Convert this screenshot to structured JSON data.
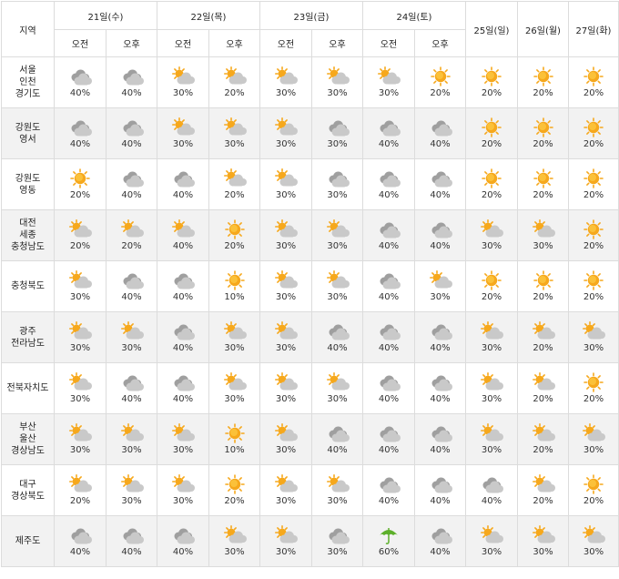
{
  "header": {
    "region_label": "지역",
    "days_split": [
      {
        "label": "21일(수)",
        "slots": [
          "오전",
          "오후"
        ]
      },
      {
        "label": "22일(목)",
        "slots": [
          "오전",
          "오후"
        ]
      },
      {
        "label": "23일(금)",
        "slots": [
          "오전",
          "오후"
        ]
      },
      {
        "label": "24일(토)",
        "slots": [
          "오전",
          "오후"
        ]
      }
    ],
    "days_single": [
      "25일(일)",
      "26일(월)",
      "27일(화)"
    ]
  },
  "rows": [
    {
      "region": [
        "서울",
        "인천",
        "경기도"
      ],
      "cells": [
        [
          "cloudy",
          "40%"
        ],
        [
          "cloudy",
          "40%"
        ],
        [
          "partly-sunny",
          "30%"
        ],
        [
          "partly-sunny",
          "20%"
        ],
        [
          "partly-sunny",
          "30%"
        ],
        [
          "partly-sunny",
          "30%"
        ],
        [
          "partly-sunny",
          "30%"
        ],
        [
          "sunny",
          "20%"
        ],
        [
          "sunny",
          "20%"
        ],
        [
          "sunny",
          "20%"
        ],
        [
          "sunny",
          "20%"
        ]
      ]
    },
    {
      "region": [
        "강원도",
        "영서"
      ],
      "cells": [
        [
          "cloudy",
          "40%"
        ],
        [
          "cloudy",
          "40%"
        ],
        [
          "partly-sunny",
          "30%"
        ],
        [
          "partly-sunny",
          "30%"
        ],
        [
          "partly-sunny",
          "30%"
        ],
        [
          "cloudy",
          "30%"
        ],
        [
          "cloudy",
          "40%"
        ],
        [
          "cloudy",
          "40%"
        ],
        [
          "sunny",
          "20%"
        ],
        [
          "sunny",
          "20%"
        ],
        [
          "sunny",
          "20%"
        ]
      ]
    },
    {
      "region": [
        "강원도",
        "영동"
      ],
      "cells": [
        [
          "sunny",
          "20%"
        ],
        [
          "cloudy",
          "40%"
        ],
        [
          "cloudy",
          "40%"
        ],
        [
          "partly-sunny",
          "20%"
        ],
        [
          "partly-sunny",
          "30%"
        ],
        [
          "cloudy",
          "30%"
        ],
        [
          "cloudy",
          "40%"
        ],
        [
          "cloudy",
          "40%"
        ],
        [
          "sunny",
          "20%"
        ],
        [
          "sunny",
          "20%"
        ],
        [
          "sunny",
          "20%"
        ]
      ]
    },
    {
      "region": [
        "대전",
        "세종",
        "충청남도"
      ],
      "cells": [
        [
          "partly-sunny",
          "20%"
        ],
        [
          "partly-sunny",
          "20%"
        ],
        [
          "partly-sunny",
          "40%"
        ],
        [
          "sunny",
          "20%"
        ],
        [
          "partly-sunny",
          "30%"
        ],
        [
          "partly-sunny",
          "30%"
        ],
        [
          "cloudy",
          "40%"
        ],
        [
          "cloudy",
          "40%"
        ],
        [
          "partly-sunny",
          "30%"
        ],
        [
          "partly-sunny",
          "30%"
        ],
        [
          "sunny",
          "20%"
        ]
      ]
    },
    {
      "region": [
        "충청북도"
      ],
      "cells": [
        [
          "partly-sunny",
          "30%"
        ],
        [
          "cloudy",
          "40%"
        ],
        [
          "cloudy",
          "40%"
        ],
        [
          "sunny",
          "10%"
        ],
        [
          "partly-sunny",
          "30%"
        ],
        [
          "partly-sunny",
          "30%"
        ],
        [
          "cloudy",
          "40%"
        ],
        [
          "partly-sunny",
          "30%"
        ],
        [
          "sunny",
          "20%"
        ],
        [
          "sunny",
          "20%"
        ],
        [
          "sunny",
          "20%"
        ]
      ]
    },
    {
      "region": [
        "광주",
        "전라남도"
      ],
      "cells": [
        [
          "partly-sunny",
          "30%"
        ],
        [
          "partly-sunny",
          "30%"
        ],
        [
          "cloudy",
          "40%"
        ],
        [
          "partly-sunny",
          "30%"
        ],
        [
          "partly-sunny",
          "30%"
        ],
        [
          "cloudy",
          "40%"
        ],
        [
          "cloudy",
          "40%"
        ],
        [
          "cloudy",
          "40%"
        ],
        [
          "partly-sunny",
          "30%"
        ],
        [
          "partly-sunny",
          "20%"
        ],
        [
          "partly-sunny",
          "30%"
        ]
      ]
    },
    {
      "region": [
        "전북자치도"
      ],
      "cells": [
        [
          "partly-sunny",
          "30%"
        ],
        [
          "cloudy",
          "40%"
        ],
        [
          "cloudy",
          "40%"
        ],
        [
          "partly-sunny",
          "30%"
        ],
        [
          "partly-sunny",
          "30%"
        ],
        [
          "partly-sunny",
          "30%"
        ],
        [
          "cloudy",
          "40%"
        ],
        [
          "cloudy",
          "40%"
        ],
        [
          "partly-sunny",
          "30%"
        ],
        [
          "partly-sunny",
          "20%"
        ],
        [
          "sunny",
          "20%"
        ]
      ]
    },
    {
      "region": [
        "부산",
        "울산",
        "경상남도"
      ],
      "cells": [
        [
          "partly-sunny",
          "30%"
        ],
        [
          "partly-sunny",
          "30%"
        ],
        [
          "partly-sunny",
          "30%"
        ],
        [
          "sunny",
          "10%"
        ],
        [
          "partly-sunny",
          "30%"
        ],
        [
          "cloudy",
          "40%"
        ],
        [
          "cloudy",
          "40%"
        ],
        [
          "cloudy",
          "40%"
        ],
        [
          "partly-sunny",
          "30%"
        ],
        [
          "partly-sunny",
          "20%"
        ],
        [
          "partly-sunny",
          "30%"
        ]
      ]
    },
    {
      "region": [
        "대구",
        "경상북도"
      ],
      "cells": [
        [
          "partly-sunny",
          "20%"
        ],
        [
          "partly-sunny",
          "30%"
        ],
        [
          "partly-sunny",
          "30%"
        ],
        [
          "sunny",
          "20%"
        ],
        [
          "partly-sunny",
          "30%"
        ],
        [
          "partly-sunny",
          "30%"
        ],
        [
          "cloudy",
          "40%"
        ],
        [
          "cloudy",
          "40%"
        ],
        [
          "cloudy",
          "40%"
        ],
        [
          "partly-sunny",
          "20%"
        ],
        [
          "sunny",
          "20%"
        ]
      ]
    },
    {
      "region": [
        "제주도"
      ],
      "cells": [
        [
          "cloudy",
          "40%"
        ],
        [
          "cloudy",
          "40%"
        ],
        [
          "cloudy",
          "40%"
        ],
        [
          "partly-sunny",
          "30%"
        ],
        [
          "partly-sunny",
          "30%"
        ],
        [
          "cloudy",
          "30%"
        ],
        [
          "umbrella",
          "60%"
        ],
        [
          "cloudy",
          "40%"
        ],
        [
          "partly-sunny",
          "30%"
        ],
        [
          "partly-sunny",
          "30%"
        ],
        [
          "partly-sunny",
          "30%"
        ]
      ]
    }
  ],
  "colors": {
    "sun": "#f6a81c",
    "sun_light": "#ffd24d",
    "cloud": "#c9c9c9",
    "cloud_dark": "#9f9f9f",
    "umbrella": "#5db02b",
    "row_alt": "#f2f2f2",
    "grid": "#dcdcdc"
  }
}
